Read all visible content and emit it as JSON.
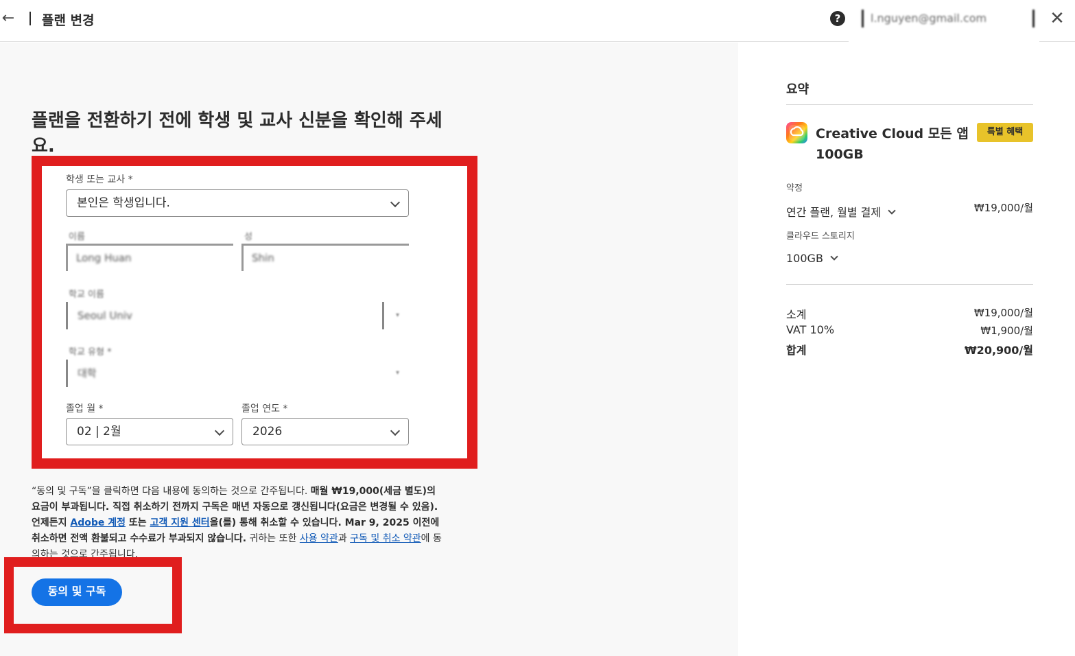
{
  "header": {
    "title": "플랜 변경",
    "user_email": "l.nguyen@gmail.com"
  },
  "main": {
    "heading": "플랜을 전환하기 전에 학생 및 교사 신분을 확인해 주세요.",
    "form": {
      "role_label": "학생 또는 교사 *",
      "role_value": "본인은 학생입니다.",
      "first_name_label": "이름",
      "first_name_value": "Long Huan",
      "last_name_label": "성",
      "last_name_value": "Shin",
      "school_label": "학교 이름",
      "school_value": "Seoul Univ",
      "type_label": "학교 유형 *",
      "type_value": "대학",
      "grad_month_label": "졸업 월 *",
      "grad_month_value": "02 | 2월",
      "grad_year_label": "졸업 연도 *",
      "grad_year_value": "2026"
    },
    "legal": {
      "t1": "“동의 및 구독”을 클릭하면 다음 내용에 동의하는 것으로 간주됩니다. ",
      "t2": "매월 ₩19,000(세금 별도)의 요금이 부과됩니다. 직접 취소하기 전까지 구독은 매년 자동으로 갱신됩니다(요금은 변경될 수 있음). 언제든지 ",
      "link_account": "Adobe 계정",
      "t3": " 또는 ",
      "link_support": "고객 지원 센터",
      "t4": "을(를) 통해 취소할 수 있습니다. Mar 9, 2025 이전에 취소하면 전액 환불되고 수수료가 부과되지 않습니다.",
      "t5": " 귀하는 또한 ",
      "link_terms": "사용 약관",
      "t6": "과 ",
      "link_cancel": "구독 및 취소 약관",
      "t7": "에 동의하는 것으로 간주됩니다."
    },
    "subscribe_button": "동의 및 구독"
  },
  "summary": {
    "title": "요약",
    "product_name": "Creative Cloud 모든 앱 100GB",
    "promo_badge": "특별 혜택",
    "commitment_label": "약정",
    "commitment_value": "연간 플랜, 월별 결제",
    "commitment_price": "₩19,000/월",
    "storage_label": "클라우드 스토리지",
    "storage_value": "100GB",
    "subtotal_label": "소계",
    "subtotal_value": "₩19,000/월",
    "vat_label": "VAT 10%",
    "vat_value": "₩1,900/월",
    "total_label": "합계",
    "total_value": "₩20,900/월"
  },
  "colors": {
    "accent_blue": "#1473e6",
    "highlight_red": "#e01e1e",
    "promo_yellow": "#e8c32a"
  }
}
